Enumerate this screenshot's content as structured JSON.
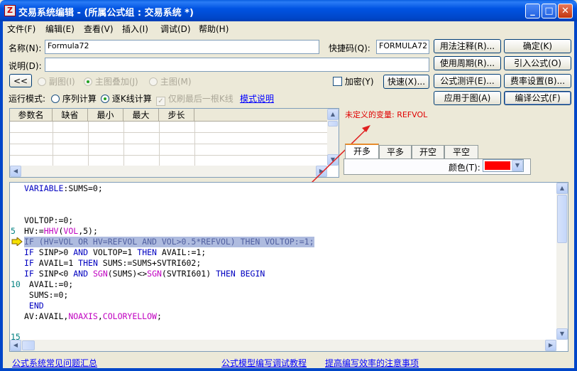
{
  "window": {
    "title": "交易系统编辑 - (所属公式组 : 交易系统 *)",
    "icon_glyph": "Z",
    "minimize": "_",
    "maximize": "□",
    "close": "✕"
  },
  "menu": [
    "文件(F)",
    "编辑(E)",
    "查看(V)",
    "插入(I)",
    "调试(D)",
    "帮助(H)"
  ],
  "form": {
    "name_label": "名称(N):",
    "name_value": "Formula72",
    "shortcut_label": "快捷码(Q):",
    "shortcut_value": "FORMULA72",
    "desc_label": "说明(D):",
    "desc_value": "",
    "collapse_btn": "<<",
    "chart_opts": [
      "副图(I)",
      "主图叠加(J)",
      "主图(M)"
    ],
    "encrypt_label": "加密(Y)",
    "fast_btn": "快速(X)...",
    "run_mode_label": "运行模式:",
    "run_opts": [
      "序列计算",
      "逐K线计算"
    ],
    "refresh_label": "仅刷最后一根K线",
    "mode_link": "模式说明"
  },
  "buttons": {
    "usage": "用法注释(R)...",
    "ok": "确定(K)",
    "period": "使用周期(R)...",
    "import": "引入公式(O)",
    "test": "公式测评(E)...",
    "rate": "费率设置(B)...",
    "apply": "应用于图(A)",
    "compile": "编译公式(F)"
  },
  "params": {
    "headers": [
      "参数名",
      "缺省",
      "最小",
      "最大",
      "步长"
    ]
  },
  "error_text": "未定义的变量: REFVOL",
  "signal_tabs": [
    "开多",
    "平多",
    "开空",
    "平空"
  ],
  "color": {
    "label": "颜色(T):",
    "value": "#ff0000"
  },
  "code_lines": [
    {
      "n": "",
      "text": "VARIABLE:SUMS=0;"
    },
    {
      "n": "",
      "text": ""
    },
    {
      "n": "",
      "text": ""
    },
    {
      "n": "",
      "text": "VOLTOP:=0;"
    },
    {
      "n": "5",
      "text": "HV:=HHV(VOL,5);"
    },
    {
      "n": "",
      "text": "IF (HV=VOL OR HV=REFVOL AND VOL>0.5*REFVOL) THEN VOLTOP:=1;"
    },
    {
      "n": "",
      "text": "IF SINP>0 AND VOLTOP=1 THEN AVAIL:=1;"
    },
    {
      "n": "",
      "text": "IF AVAIL=1 THEN SUMS:=SUMS+SVTRI602;"
    },
    {
      "n": "",
      "text": "IF SINP<0 AND SGN(SUMS)<>SGN(SVTRI601) THEN BEGIN"
    },
    {
      "n": "10",
      "text": " AVAIL:=0;"
    },
    {
      "n": "",
      "text": " SUMS:=0;"
    },
    {
      "n": "",
      "text": " END"
    },
    {
      "n": "",
      "text": "AV:AVAIL,NOAXIS,COLORYELLOW;"
    },
    {
      "n": "",
      "text": ""
    },
    {
      "n": "15",
      "text": ""
    }
  ],
  "footer_links": [
    "公式系统常见问题汇总",
    "公式模型编写调试教程",
    "提高编写效率的注意事项"
  ]
}
